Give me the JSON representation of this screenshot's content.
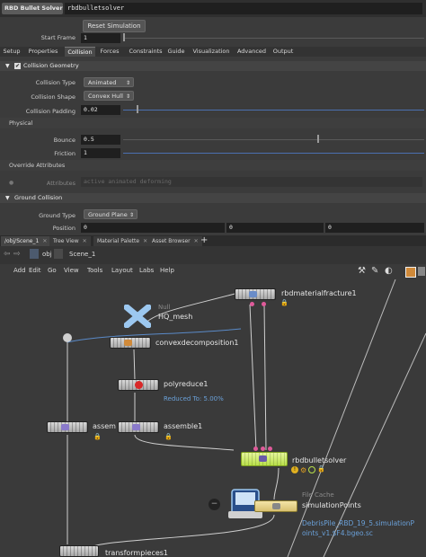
{
  "header": {
    "node_type": "RBD Bullet Solver",
    "node_name": "rbdbulletsolver"
  },
  "toolbar": {
    "reset_label": "Reset Simulation",
    "start_frame_label": "Start Frame",
    "start_frame_value": "1"
  },
  "tabs": [
    "Setup",
    "Properties",
    "Collision",
    "Forces",
    "Constraints",
    "Guide",
    "Visualization",
    "Advanced",
    "Output"
  ],
  "collision_geometry": {
    "folder_label": "Collision Geometry",
    "collision_type_label": "Collision Type",
    "collision_type_value": "Animated",
    "collision_shape_label": "Collision Shape",
    "collision_shape_value": "Convex Hull",
    "collision_padding_label": "Collision Padding",
    "collision_padding_value": "0.02",
    "physical_label": "Physical",
    "bounce_label": "Bounce",
    "bounce_value": "0.5",
    "friction_label": "Friction",
    "friction_value": "1",
    "override_label": "Override Attributes",
    "attributes_label": "Attributes",
    "attributes_value": "active animated deforming"
  },
  "ground_collision": {
    "folder_label": "Ground Collision",
    "ground_type_label": "Ground Type",
    "ground_type_value": "Ground Plane",
    "position_label": "Position",
    "position_x": "0",
    "position_y": "0",
    "position_z": "0"
  },
  "pane_tabs": [
    "/obj/Scene_1",
    "Tree View",
    "Material Palette",
    "Asset Browser"
  ],
  "path": {
    "root": "obj",
    "scene": "Scene_1"
  },
  "menu": [
    "Add",
    "Edit",
    "Go",
    "View",
    "Tools",
    "Layout",
    "Labs",
    "Help"
  ],
  "network": {
    "rbdmaterialfracture": "rbdmaterialfracture1",
    "null_type": "Null",
    "null_name": "HQ_mesh",
    "convexdecomposition": "convexdecomposition1",
    "polyreduce": "polyreduce1",
    "polyreduce_info": "Reduced To: 5.00%",
    "assemble_left": "assem",
    "assemble": "assemble1",
    "rbdbulletsolver": "rbdbulletsolver",
    "filecache_type": "File Cache",
    "filecache_name": "simulationPoints",
    "filecache_path_1": "DebrisPile_RBD_19_5.simulationP",
    "filecache_path_2": "oints_v1.$F4.bgeo.sc",
    "transform": "transformpieces1"
  },
  "colors": {
    "accent_green": "#b8e04a",
    "info_blue": "#6aa0d8",
    "pink": "#e05a9a"
  }
}
